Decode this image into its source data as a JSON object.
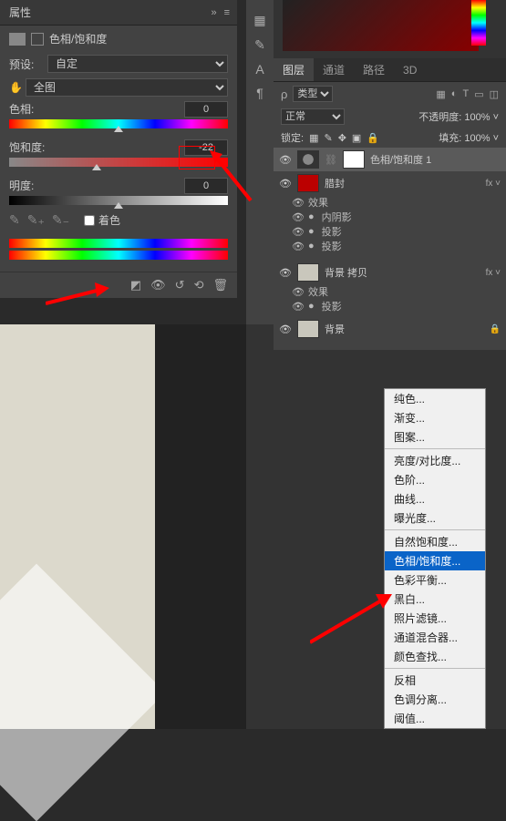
{
  "properties": {
    "panel_title": "属性",
    "adjustment_title": "色相/饱和度",
    "preset_label": "预设:",
    "preset_value": "自定",
    "range_value": "全图",
    "hue_label": "色相:",
    "hue_value": "0",
    "saturation_label": "饱和度:",
    "saturation_value": "-22",
    "lightness_label": "明度:",
    "lightness_value": "0",
    "colorize_label": "着色"
  },
  "right": {
    "tabs": {
      "layers": "图层",
      "channels": "通道",
      "paths": "路径",
      "threed": "3D"
    },
    "type_label": "类型",
    "blend_mode": "正常",
    "opacity_label": "不透明度:",
    "opacity_value": "100%",
    "lock_label": "锁定:",
    "fill_label": "填充:",
    "fill_value": "100%"
  },
  "layers": {
    "hsl_layer": "色相/饱和度 1",
    "seal_layer": "腊封",
    "effects": "效果",
    "inner_shadow": "内阴影",
    "drop_shadow": "投影",
    "bg_copy": "背景 拷贝",
    "bg": "背景"
  },
  "menu": {
    "solid": "纯色...",
    "gradient": "渐变...",
    "pattern": "图案...",
    "bc": "亮度/对比度...",
    "levels": "色阶...",
    "curves": "曲线...",
    "exposure": "曝光度...",
    "vibrance": "自然饱和度...",
    "hsl": "色相/饱和度...",
    "balance": "色彩平衡...",
    "bw": "黑白...",
    "photo_filter": "照片滤镜...",
    "mixer": "通道混合器...",
    "lookup": "颜色查找...",
    "invert": "反相",
    "posterize": "色调分离...",
    "threshold": "阈值..."
  }
}
